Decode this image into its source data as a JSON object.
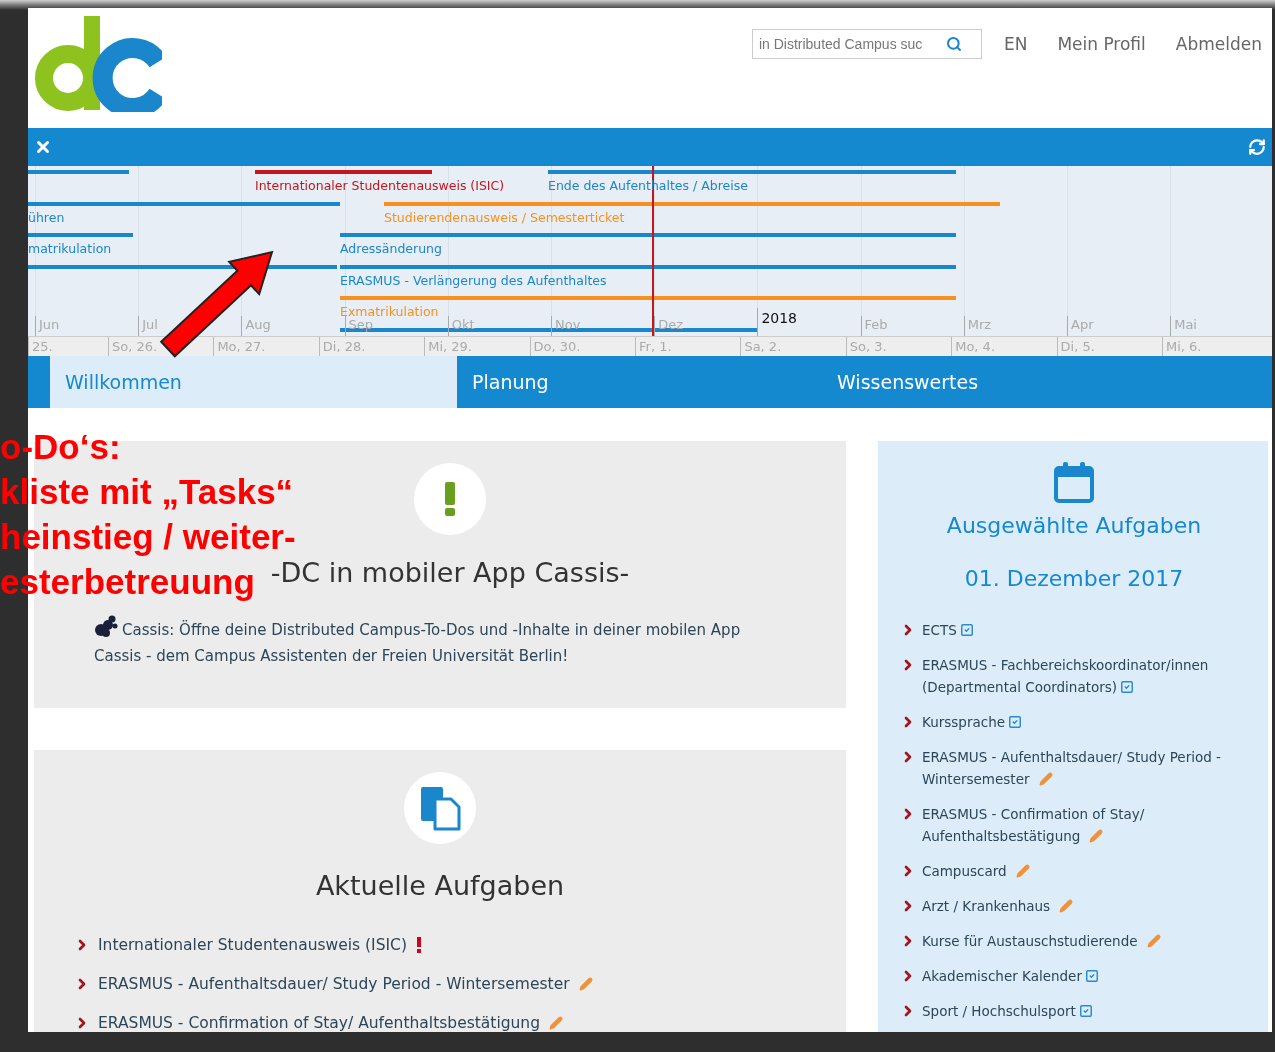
{
  "header": {
    "search": {
      "placeholder": "in Distributed Campus suc"
    },
    "nav": [
      "EN",
      "Mein Profil",
      "Abmelden"
    ]
  },
  "timeline": {
    "items": [
      {
        "color": "#1a87cc"
      },
      {
        "label": "Internationaler Studentenausweis (ISIC)",
        "color": "#c4161c"
      },
      {
        "label": "Ende des Aufenthaltes / Abreise",
        "color": "#1a87cc"
      },
      {
        "label": "ühren",
        "color": "#1a87cc"
      },
      {
        "label": "Studierendenausweis / Semesterticket",
        "color": "#f7901e"
      },
      {
        "label": "matrikulation",
        "color": "#1a87cc"
      },
      {
        "label": "Adressänderung",
        "color": "#1a87cc"
      },
      {
        "color": "#1a87cc"
      },
      {
        "label": "ERASMUS - Verlängerung des Aufenthaltes",
        "color": "#1a87cc"
      },
      {
        "label": "Exmatrikulation",
        "color": "#f7901e"
      },
      {
        "color": "#1a87cc"
      }
    ],
    "months": [
      {
        "label": "Jun",
        "kind": "month"
      },
      {
        "label": "Jul",
        "kind": "month"
      },
      {
        "label": "Aug",
        "kind": "month"
      },
      {
        "label": "Sep",
        "kind": "month"
      },
      {
        "label": "Okt",
        "kind": "month"
      },
      {
        "label": "Nov",
        "kind": "month"
      },
      {
        "label": "Dez",
        "kind": "month"
      },
      {
        "label": "2018",
        "kind": "year"
      },
      {
        "label": "Feb",
        "kind": "month"
      },
      {
        "label": "Mrz",
        "kind": "month"
      },
      {
        "label": "Apr",
        "kind": "month"
      },
      {
        "label": "Mai",
        "kind": "month"
      }
    ],
    "days": [
      "25.",
      "So, 26.",
      "Mo, 27.",
      "Di, 28.",
      "Mi, 29.",
      "Do, 30.",
      "Fr, 1.",
      "Sa, 2.",
      "So, 3.",
      "Mo, 4.",
      "Di, 5.",
      "Mi, 6."
    ]
  },
  "tabs": [
    {
      "label": "Willkommen",
      "selected": true
    },
    {
      "label": "Planung",
      "selected": false
    },
    {
      "label": "Wissenswertes",
      "selected": false
    }
  ],
  "cassis_card": {
    "heading": "-DC in mobiler App Cassis-",
    "text": "Cassis: Öffne deine Distributed Campus-To-Dos und -Inhalte in deiner mobilen App Cassis - dem Campus Assistenten der Freien Universität Berlin!"
  },
  "current_tasks": {
    "title": "Aktuelle Aufgaben",
    "items": [
      {
        "label": "Internationaler Studentenausweis (ISIC)",
        "kind": "alert"
      },
      {
        "label": "ERASMUS - Aufenthaltsdauer/ Study Period - Wintersemester",
        "kind": "edit"
      },
      {
        "label": "ERASMUS - Confirmation of Stay/ Aufenthaltsbestätigung",
        "kind": "edit"
      }
    ]
  },
  "selected_tasks": {
    "title": "Ausgewählte Aufgaben",
    "date": "01. Dezember 2017",
    "items": [
      {
        "label": "ECTS",
        "kind": "done"
      },
      {
        "label": "ERASMUS - Fachbereichskoordinator/innen (Departmental Coordinators)",
        "kind": "done"
      },
      {
        "label": "Kurssprache",
        "kind": "done"
      },
      {
        "label": "ERASMUS - Aufenthaltsdauer/ Study Period - Wintersemester",
        "kind": "edit"
      },
      {
        "label": "ERASMUS - Confirmation of Stay/ Aufenthaltsbestätigung",
        "kind": "edit"
      },
      {
        "label": "Campuscard",
        "kind": "edit"
      },
      {
        "label": "Arzt / Krankenhaus",
        "kind": "edit"
      },
      {
        "label": "Kurse für Austauschstudierende",
        "kind": "edit"
      },
      {
        "label": "Akademischer Kalender",
        "kind": "done"
      },
      {
        "label": "Sport / Hochschulsport",
        "kind": "done"
      }
    ]
  },
  "annotation": {
    "lines": [
      "o-Do‘s:",
      "kliste mit „Tasks“",
      "heinstieg / weiter-",
      "esterbetreuung"
    ]
  }
}
